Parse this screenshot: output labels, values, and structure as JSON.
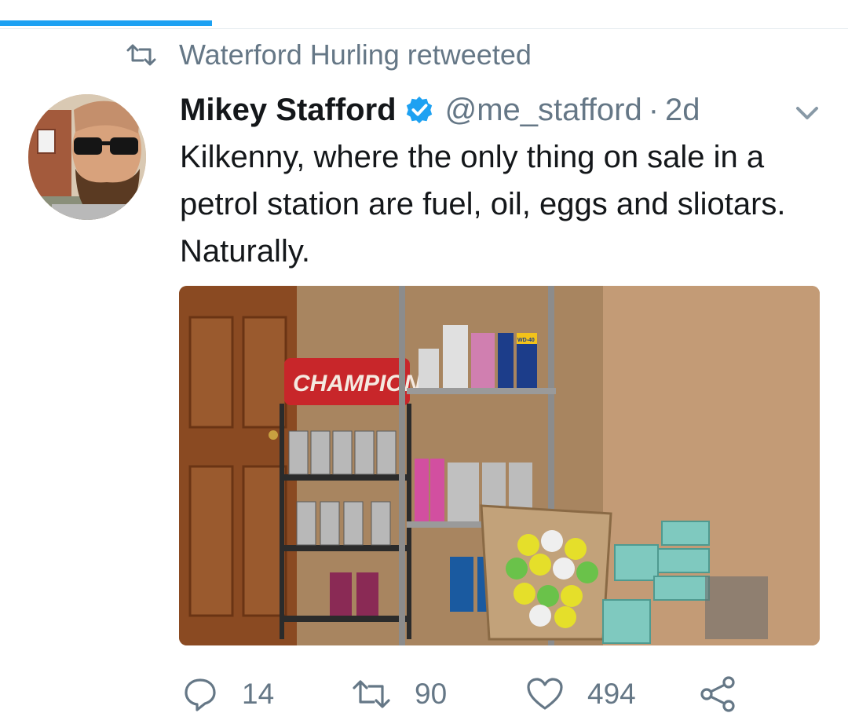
{
  "progress": {
    "fraction": 0.25,
    "color": "#1da1f2"
  },
  "retweet_context": {
    "icon": "retweet-icon",
    "text": "Waterford Hurling retweeted"
  },
  "tweet": {
    "avatar_icon": "user-avatar",
    "display_name": "Mikey Stafford",
    "verified_icon": "verified-badge-icon",
    "handle": "@me_stafford",
    "separator": "·",
    "time": "2d",
    "menu_icon": "chevron-down-icon",
    "text": "Kilkenny, where the only thing on sale in a petrol station are fuel, oil, eggs and sliotars. Naturally.",
    "media": {
      "sign_text": "CHAMPION",
      "can_label": "WD-40"
    }
  },
  "actions": {
    "reply": {
      "icon": "reply-icon",
      "count": "14"
    },
    "retweet": {
      "icon": "retweet-icon",
      "count": "90"
    },
    "like": {
      "icon": "heart-icon",
      "count": "494"
    },
    "share": {
      "icon": "share-icon"
    }
  },
  "colors": {
    "accent": "#1da1f2",
    "secondary_text": "#657786",
    "primary_text": "#14171a"
  }
}
